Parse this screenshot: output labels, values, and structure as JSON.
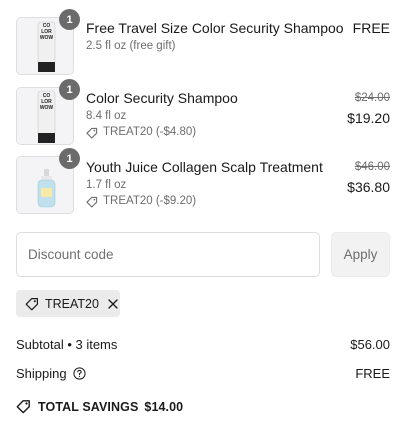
{
  "items": [
    {
      "quantity": "1",
      "title": "Free Travel Size Color Security Shampoo",
      "variant": "2.5 fl oz (free gift)",
      "price": "FREE"
    },
    {
      "quantity": "1",
      "title": "Color Security Shampoo",
      "variant": "8.4 fl oz",
      "discount": "TREAT20 (-$4.80)",
      "original_price": "$24.00",
      "price": "$19.20"
    },
    {
      "quantity": "1",
      "title": "Youth Juice Collagen Scalp Treatment",
      "variant": "1.7 fl oz",
      "discount": "TREAT20 (-$9.20)",
      "original_price": "$46.00",
      "price": "$36.80"
    }
  ],
  "discount_form": {
    "placeholder": "Discount code",
    "value": "",
    "apply_label": "Apply"
  },
  "applied_code": {
    "code": "TREAT20"
  },
  "summary": {
    "subtotal_label": "Subtotal • 3 items",
    "subtotal_value": "$56.00",
    "shipping_label": "Shipping",
    "shipping_value": "FREE",
    "savings_label": "TOTAL SAVINGS",
    "savings_value": "$14.00"
  },
  "icons": {
    "tag": "tag-icon",
    "remove": "close-icon",
    "help": "question-circle-icon",
    "savings": "tag-icon"
  }
}
